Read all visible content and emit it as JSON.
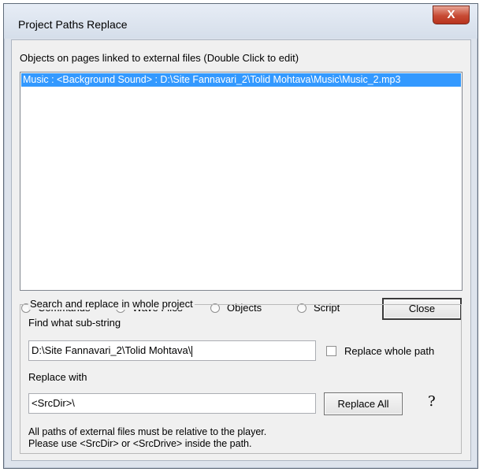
{
  "window": {
    "title": "Project Paths Replace",
    "close_glyph": "X"
  },
  "list": {
    "label": "Objects on pages linked to external files (Double Click to edit)",
    "items": [
      "Music : <Background Sound> : D:\\Site Fannavari_2\\Tolid Mohtava\\Music\\Music_2.mp3"
    ],
    "selected_index": 0
  },
  "filters": {
    "options": [
      {
        "label": "Commands",
        "checked": false
      },
      {
        "label": "Wave Files",
        "checked": true
      },
      {
        "label": "Objects",
        "checked": false
      },
      {
        "label": "Script",
        "checked": false
      }
    ]
  },
  "buttons": {
    "close": "Close",
    "replace_all": "Replace All"
  },
  "group": {
    "title": "Search and replace in whole project",
    "find_label": "Find what sub-string",
    "find_value": "D:\\Site Fannavari_2\\Tolid Mohtava\\",
    "replace_whole_path_label": "Replace whole path",
    "replace_whole_path_checked": false,
    "replace_label": "Replace with",
    "replace_value": "<SrcDir>\\",
    "help_glyph": "?",
    "note_line1": "All paths of external files must be relative to the player.",
    "note_line2": "Please use <SrcDir> or <SrcDrive> inside the path."
  },
  "icons": {
    "help": "help-icon",
    "close": "close-icon"
  }
}
